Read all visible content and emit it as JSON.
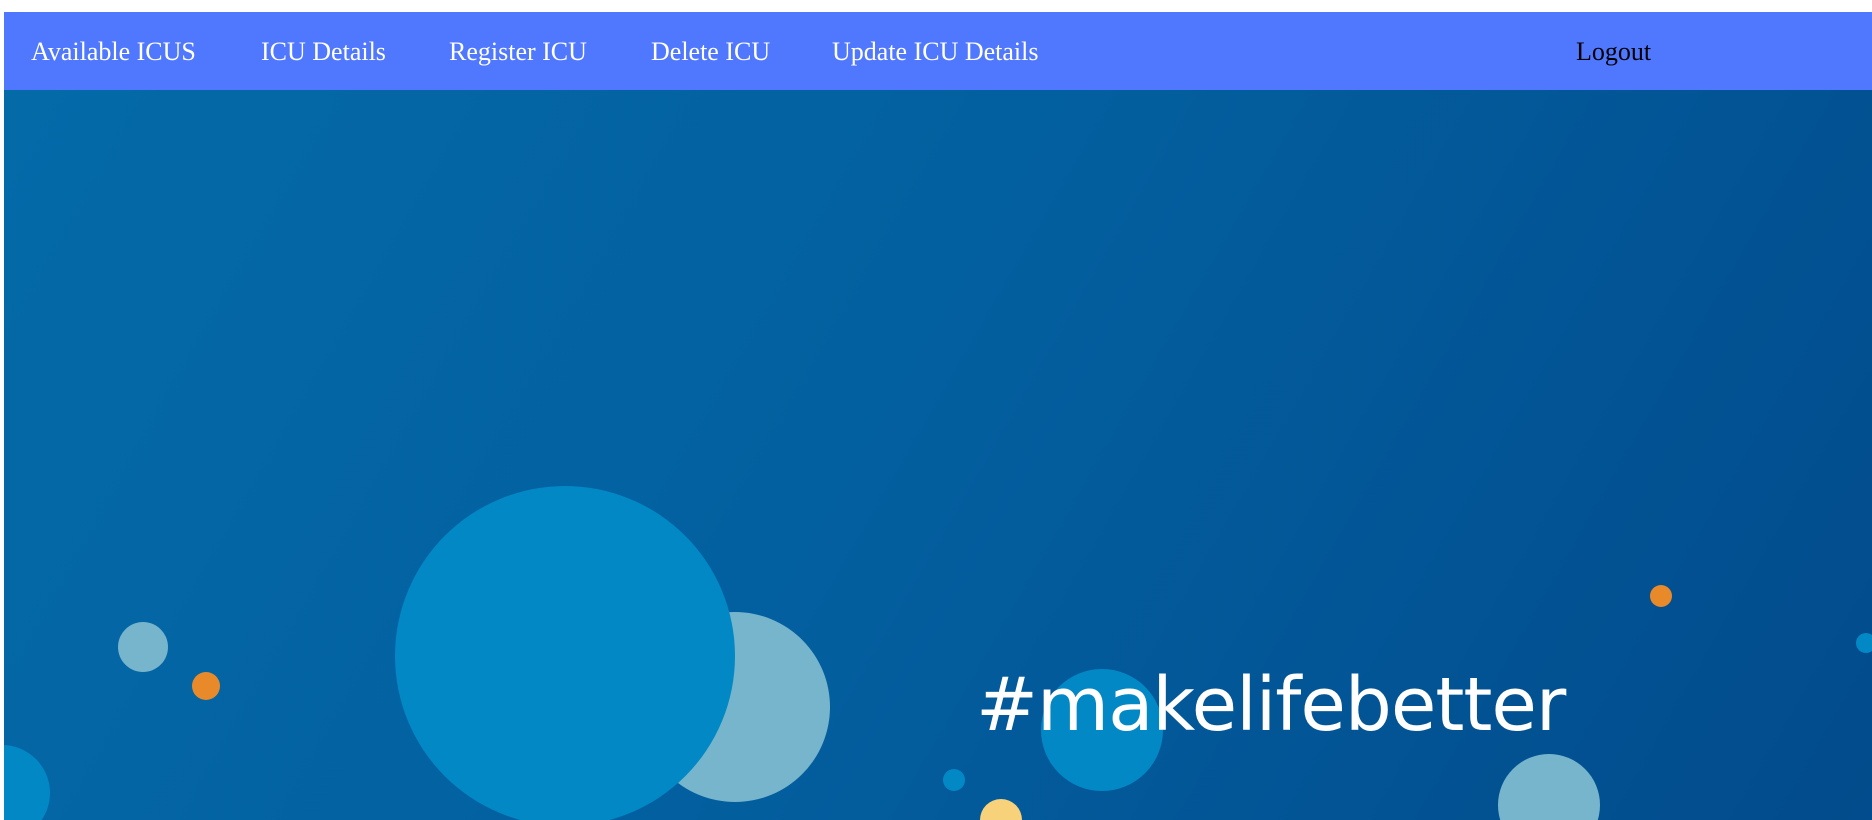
{
  "nav": {
    "items": [
      {
        "label": "Available ICUS"
      },
      {
        "label": "ICU Details"
      },
      {
        "label": "Register ICU"
      },
      {
        "label": "Delete ICU"
      },
      {
        "label": "Update ICU Details"
      }
    ],
    "logout_label": "Logout"
  },
  "hero": {
    "tagline": "#makelifebetter"
  },
  "colors": {
    "navbar": "#5078ff",
    "hero_background": "#0360a0",
    "bubble_blue": "#0288c5",
    "bubble_light": "#76b5cc",
    "bubble_orange": "#e88a2a",
    "bubble_yellow": "#f7d27a"
  }
}
